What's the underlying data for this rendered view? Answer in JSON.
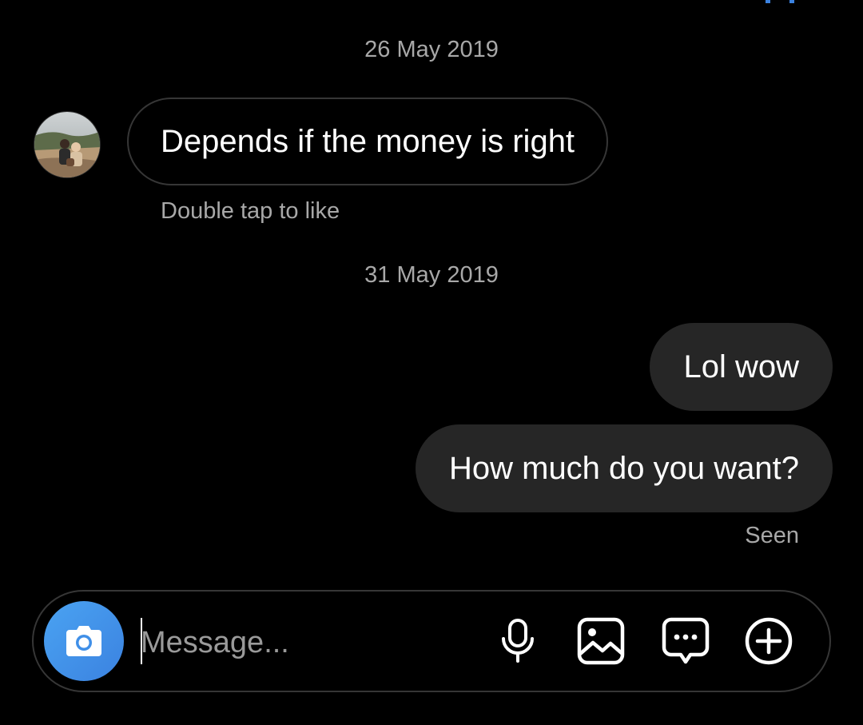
{
  "thread": {
    "date_1": "26 May 2019",
    "incoming_message": "Depends if the money is right",
    "double_tap_hint": "Double tap to like",
    "date_2": "31 May 2019",
    "outgoing_messages": [
      "Lol wow",
      "How much do you want?"
    ],
    "seen_label": "Seen"
  },
  "composer": {
    "placeholder": "Message...",
    "icons": [
      "camera-icon",
      "microphone-icon",
      "gallery-icon",
      "sticker-icon",
      "add-icon"
    ]
  },
  "colors": {
    "background": "#000000",
    "outgoing_bubble": "#262626",
    "incoming_border": "#363636",
    "muted_text": "#a8a8a8",
    "camera_button": "#3b82e0"
  }
}
